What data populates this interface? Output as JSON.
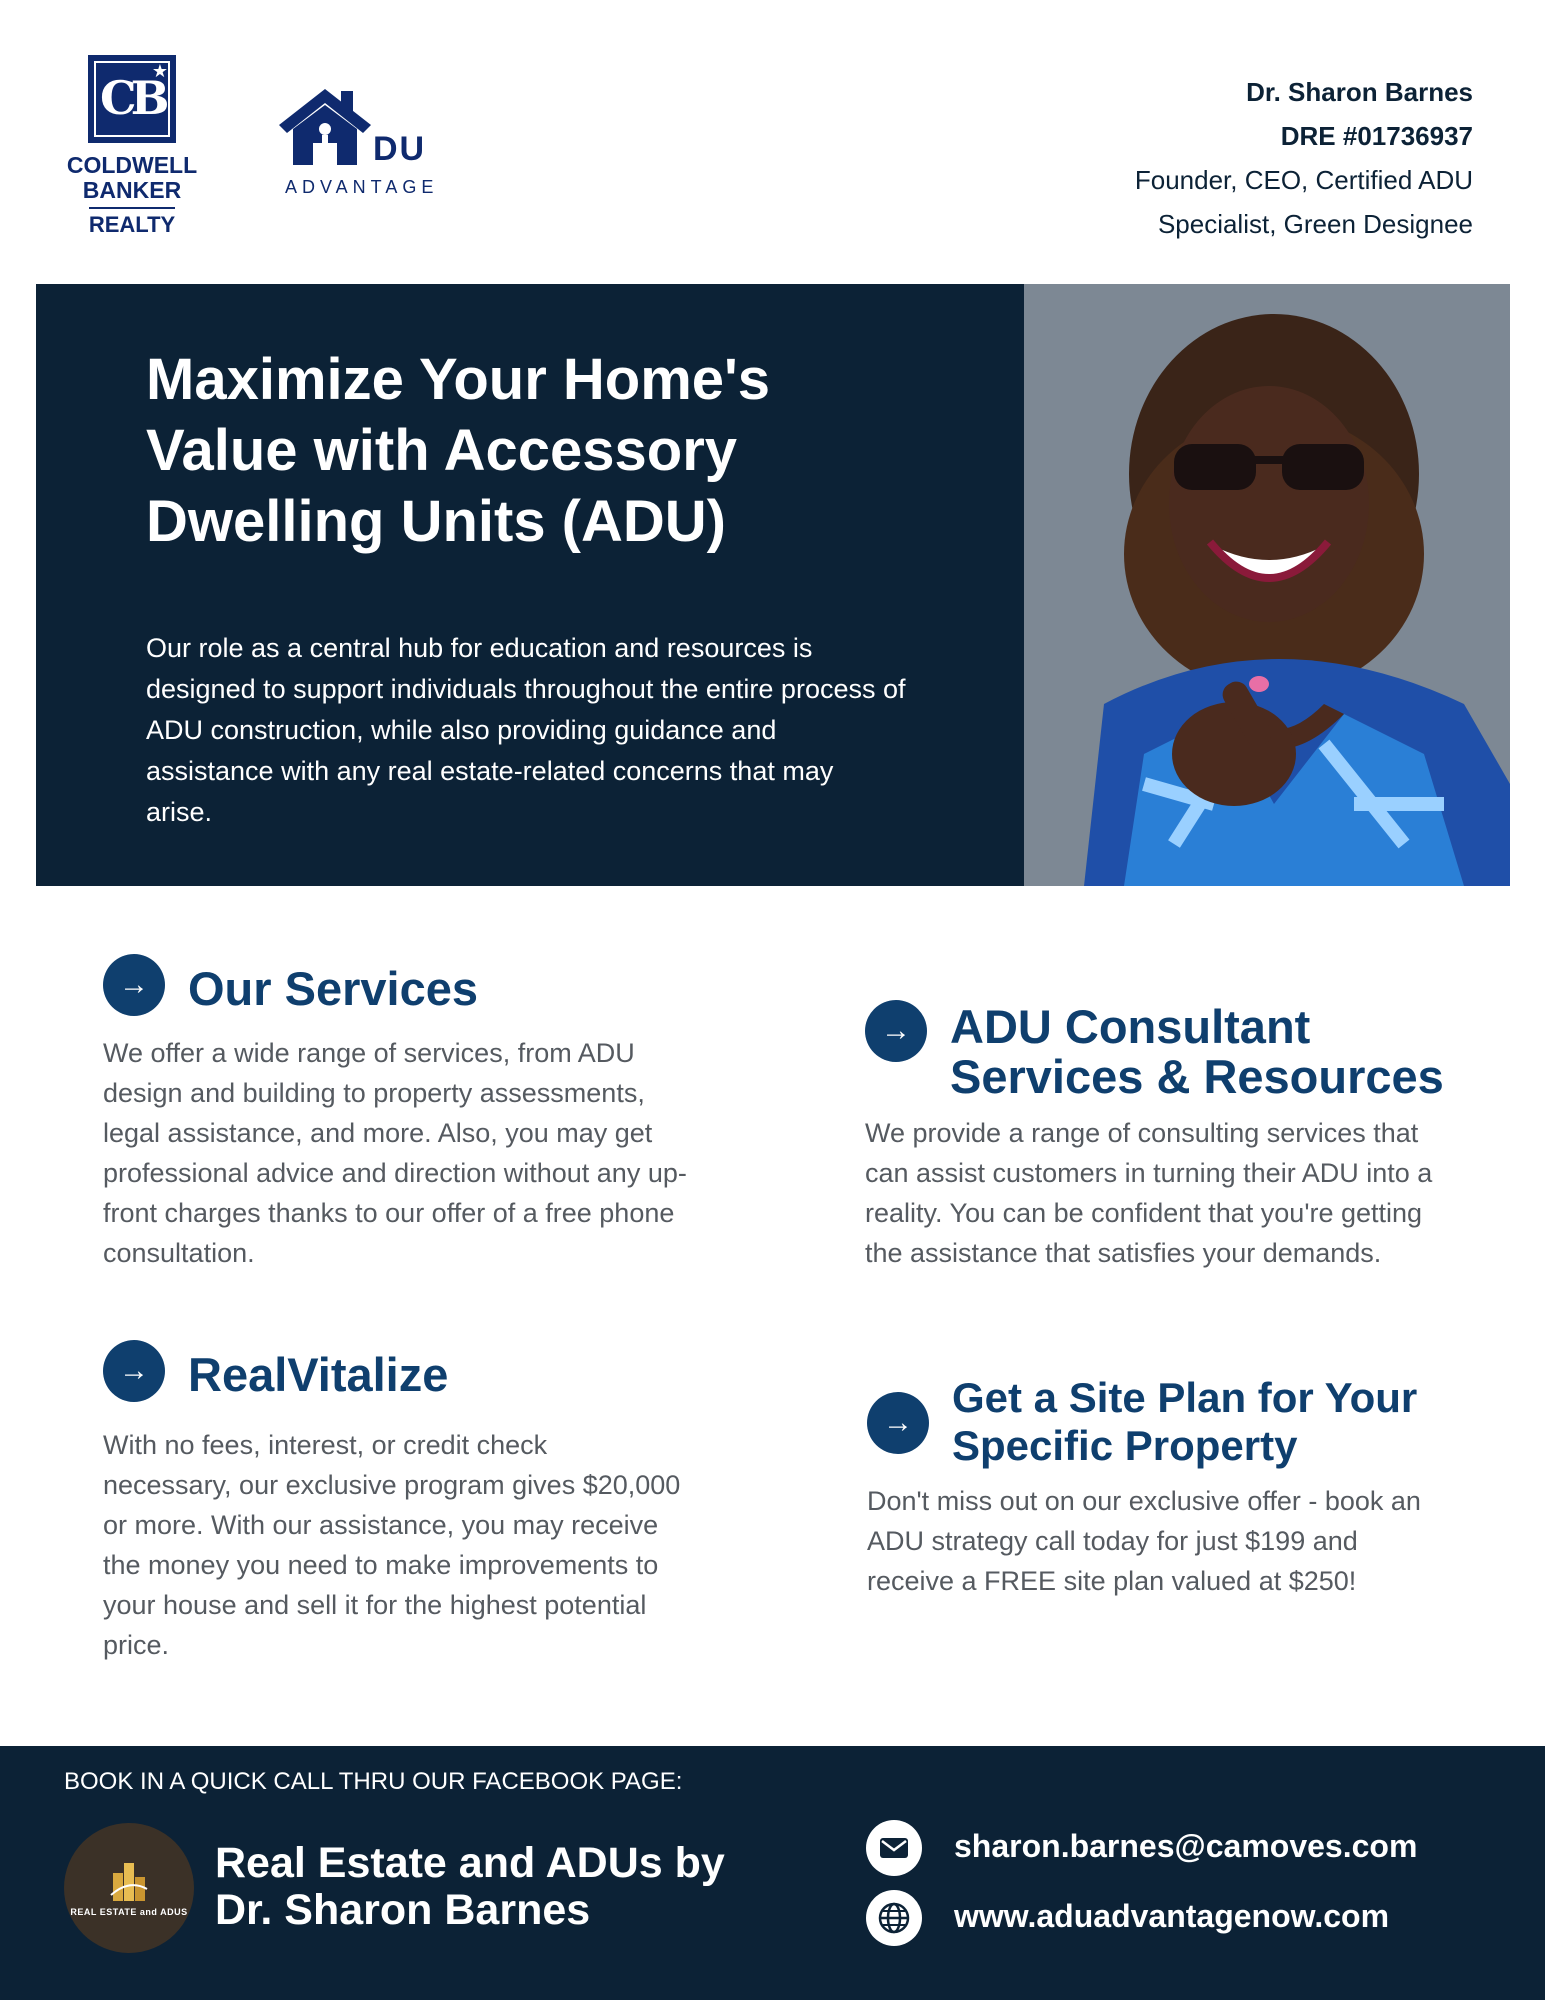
{
  "header": {
    "coldwell_logo_lines": [
      "COLDWELL",
      "BANKER",
      "REALTY"
    ],
    "adu_logo": {
      "du": "DU",
      "tagline": "ADVANTAGE"
    },
    "contact": {
      "name": "Dr. Sharon Barnes",
      "dre": "DRE #01736937",
      "role_line1": "Founder, CEO, Certified ADU",
      "role_line2": "Specialist, Green Designee"
    }
  },
  "hero": {
    "title_line1": "Maximize Your Home's",
    "title_line2": "Value with Accessory",
    "title_line3": "Dwelling Units (ADU)",
    "description": "Our role as a central hub for education and resources is designed to support individuals throughout the entire process of ADU construction, while also providing guidance and assistance with any real estate-related concerns that may arise."
  },
  "sections": {
    "services": {
      "title": "Our Services",
      "body": "We offer a wide range of services, from ADU design and building to property assessments, legal assistance, and more. Also, you may get professional advice and direction without any up-front charges thanks to our offer of a free phone consultation."
    },
    "realvitalize": {
      "title": "RealVitalize",
      "body": "With no fees, interest, or credit check necessary, our exclusive program gives $20,000 or more. With our assistance, you may receive the money you need to make improvements to your house and sell it for the highest potential price."
    },
    "consultant": {
      "title_line1": "ADU Consultant",
      "title_line2": "Services & Resources",
      "body": "We provide a range of consulting services that can assist customers in turning their ADU into a reality. You can be confident that you're getting the assistance that satisfies your demands."
    },
    "siteplan": {
      "title_line1": "Get a Site Plan for Your",
      "title_line2": "Specific Property",
      "body": "Don't miss out on our exclusive offer - book an ADU strategy call today for just $199 and receive a FREE site plan valued at $250!"
    }
  },
  "footer": {
    "book_text": "BOOK IN A QUICK CALL THRU OUR FACEBOOK PAGE:",
    "logo_text": "REAL ESTATE and ADUS",
    "page_name_line1": "Real Estate and ADUs by",
    "page_name_line2": "Dr. Sharon Barnes",
    "email": "sharon.barnes@camoves.com",
    "website": "www.aduadvantagenow.com"
  },
  "colors": {
    "navy": "#0c2236",
    "accent_blue": "#0f3f6e",
    "logo_blue": "#0f2a6e",
    "photo_bg": "#7d8894"
  }
}
